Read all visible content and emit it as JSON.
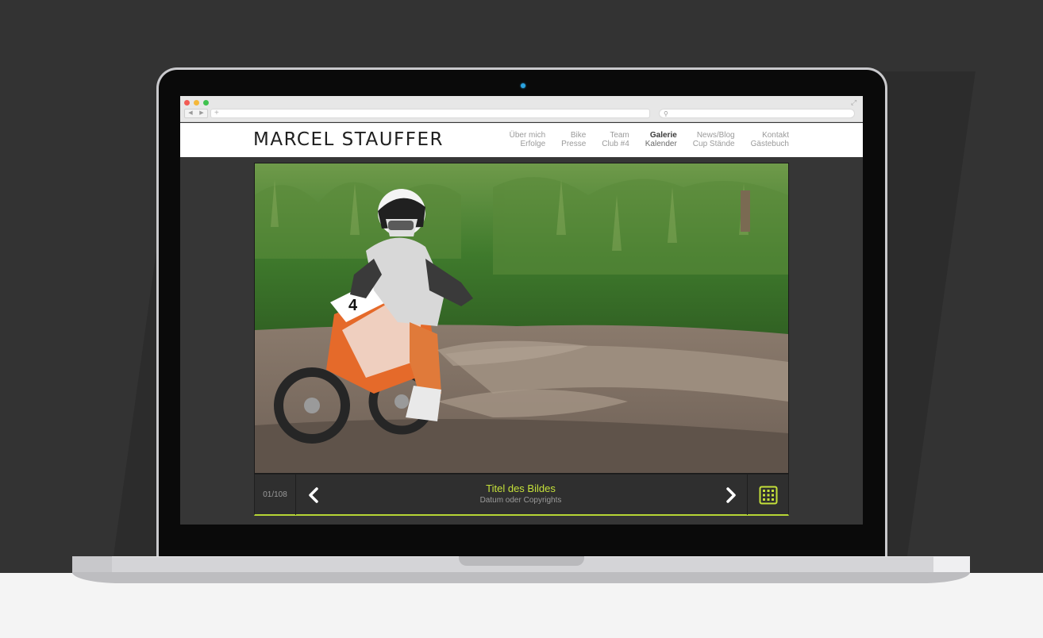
{
  "site": {
    "logo": "MARCEL STAUFFER",
    "nav": [
      {
        "line1": "Über mich",
        "line2": "Erfolge",
        "active": false
      },
      {
        "line1": "Bike",
        "line2": "Presse",
        "active": false
      },
      {
        "line1": "Team",
        "line2": "Club #4",
        "active": false
      },
      {
        "line1": "Galerie",
        "line2": "Kalender",
        "active": true
      },
      {
        "line1": "News/Blog",
        "line2": "Cup Stände",
        "active": false
      },
      {
        "line1": "Kontakt",
        "line2": "Gästebuch",
        "active": false
      }
    ]
  },
  "gallery": {
    "counter": "01/108",
    "title": "Titel des Bildes",
    "subtitle": "Datum oder Copyrights",
    "accent_color": "#b7d635"
  },
  "icons": {
    "prev": "chevron-left-icon",
    "next": "chevron-right-icon",
    "grid": "grid-icon",
    "search": "search-icon",
    "expand": "expand-icon"
  }
}
